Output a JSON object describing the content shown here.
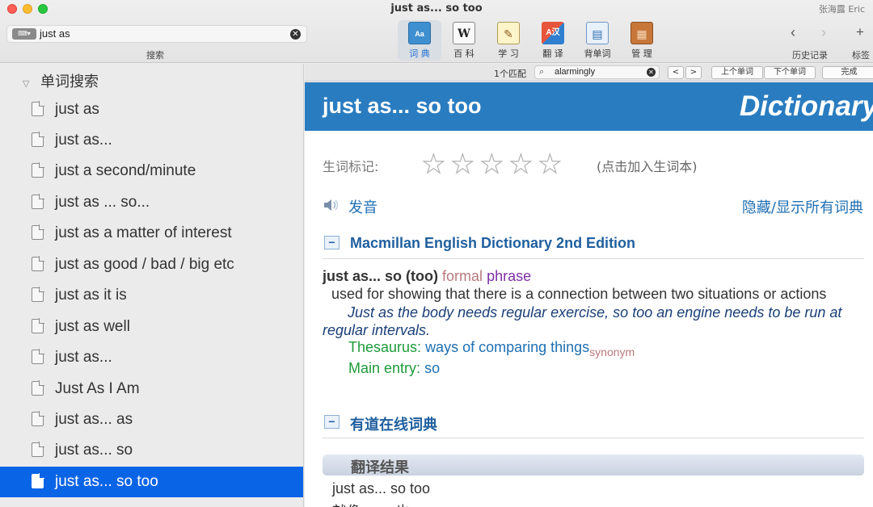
{
  "window": {
    "title": "just as... so too",
    "user": "张海露 Eric"
  },
  "search": {
    "scope_label": "⌨▾",
    "value": "just as",
    "caption": "搜索"
  },
  "toolbar": {
    "buttons": [
      {
        "label": "词 典",
        "icon": "dictionary-book-icon",
        "glyph": "Aa"
      },
      {
        "label": "百 科",
        "icon": "wikipedia-icon",
        "glyph": "W"
      },
      {
        "label": "学 习",
        "icon": "study-notepad-icon",
        "glyph": "✎"
      },
      {
        "label": "翻 译",
        "icon": "translate-icon",
        "glyph": "A汉"
      },
      {
        "label": "背单词",
        "icon": "flashcard-book-icon",
        "glyph": "▤"
      },
      {
        "label": "管 理",
        "icon": "cabinet-icon",
        "glyph": "▦"
      }
    ],
    "history_caption": "历史记录",
    "bookmark_caption": "标签"
  },
  "sidebar": {
    "heading": "单词搜索",
    "items": [
      {
        "label": "just as"
      },
      {
        "label": "just as..."
      },
      {
        "label": "just a second/minute"
      },
      {
        "label": "just as ... so..."
      },
      {
        "label": "just as a matter of interest"
      },
      {
        "label": "just as good / bad / big etc"
      },
      {
        "label": "just as it is"
      },
      {
        "label": "just as well"
      },
      {
        "label": "just as..."
      },
      {
        "label": "Just As I Am"
      },
      {
        "label": "just as... as"
      },
      {
        "label": "just as... so"
      },
      {
        "label": "just as... so too"
      }
    ],
    "selected_index": 12
  },
  "findbar": {
    "match_count": "1个匹配",
    "query": "alarmingly",
    "prev_word": "上个单词",
    "next_word": "下个单词",
    "done": "完成"
  },
  "entry": {
    "title": "just as... so too",
    "brand": "Dictionary",
    "rating_label": "生词标记:",
    "rating_stars": 0,
    "rating_max": 5,
    "rating_hint": "(点击加入生词本)",
    "pronounce": "发音",
    "toggle_all": "隐藏/显示所有词典",
    "macmillan": {
      "section_title": "Macmillan English Dictionary 2nd Edition",
      "headword": "just as... so (too)",
      "register": "formal",
      "pos": "phrase",
      "definition": "used for showing that there is a connection between two situations or actions",
      "example": "Just as the body needs regular exercise, so too an engine needs to be run at regular intervals.",
      "thesaurus_key": "Thesaurus:",
      "thesaurus_value": "ways of comparing things",
      "thesaurus_tag": "synonym",
      "main_entry_key": "Main entry:",
      "main_entry_value": "so"
    },
    "youdao": {
      "section_title": "有道在线词典",
      "translation_heading": "翻译结果",
      "source": "just as... so too",
      "result": "就像…… 也"
    }
  },
  "colors": {
    "banner": "#2a7cc0",
    "selection": "#0a64e6",
    "link": "#1f6fb3"
  }
}
